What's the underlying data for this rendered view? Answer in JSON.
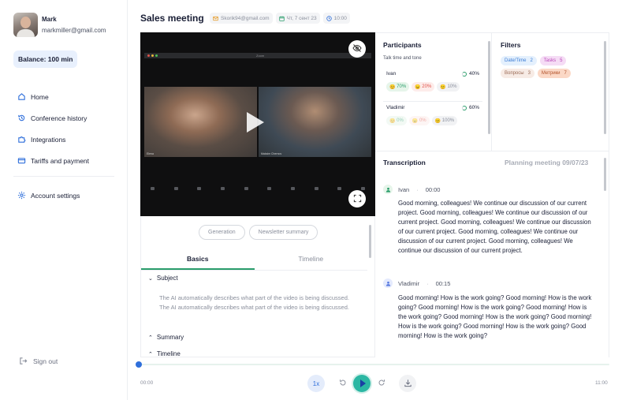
{
  "profile": {
    "name": "Mark",
    "email": "markmiller@gmail.com"
  },
  "balance": "Balance: 100 min",
  "nav": {
    "items": [
      {
        "label": "Home",
        "icon": "home-icon"
      },
      {
        "label": "Conference history",
        "icon": "history-icon"
      },
      {
        "label": "Integrations",
        "icon": "puzzle-icon"
      },
      {
        "label": "Tariffs and payment",
        "icon": "card-icon"
      }
    ],
    "settings": {
      "label": "Account settings",
      "icon": "gear-icon"
    },
    "signout": {
      "label": "Sign out",
      "icon": "signout-icon"
    }
  },
  "header": {
    "title": "Sales meeting",
    "email": "Skorik94@gmail.com",
    "date": "Чт, 7 сент 23",
    "time": "10:00"
  },
  "video": {
    "app_title": "Zoom",
    "feed1_name": "Elena",
    "feed2_name": "Maksim Chernov"
  },
  "actions": {
    "generation": "Generation",
    "newsletter": "Newsletter summary"
  },
  "tabs": {
    "basics": "Basics",
    "timeline": "Timeline"
  },
  "sections": {
    "subject": "Subject",
    "subject_text": "The AI automatically describes what part of the video is being discussed. The AI automatically describes what part of the video is being discussed.",
    "summary": "Summary",
    "timeline": "Timeline"
  },
  "participants": {
    "title": "Participants",
    "subtitle": "Talk time and tone",
    "people": [
      {
        "name": "Ivan",
        "pct": "40%",
        "pos": "70%",
        "neg": "20%",
        "neu": "10%"
      },
      {
        "name": "Vladimir",
        "pct": "60%",
        "pos": "0%",
        "neg": "0%",
        "neu": "100%"
      }
    ]
  },
  "filters": {
    "title": "Filters",
    "tags": [
      {
        "label": "Date/Time",
        "count": "2"
      },
      {
        "label": "Tasks",
        "count": "5"
      },
      {
        "label": "Вопросы",
        "count": "3"
      },
      {
        "label": "Метрики",
        "count": "7"
      }
    ]
  },
  "transcription": {
    "title": "Transcription",
    "meeting": "Planning meeting 09/07/23",
    "entries": [
      {
        "speaker": "Ivan",
        "time": "00:00",
        "text": "Good morning, colleagues! We continue our discussion of our current project. Good morning, colleagues! We continue our discussion of our current project. Good morning, colleagues! We continue our discussion of our current project. Good morning, colleagues! We continue our discussion of our current project. Good morning, colleagues! We continue our discussion of our current project."
      },
      {
        "speaker": "Vladimir",
        "time": "00:15",
        "text": "Good morning! How is the work going? Good morning! How is the work going? Good morning! How is the work going? Good morning! How is the work going? Good morning! How is the work going? Good morning! How is the work going? Good morning! How is the work going? Good morning! How is the work going?"
      }
    ]
  },
  "player": {
    "start": "00:00",
    "end": "11:00",
    "speed": "1x",
    "progress": 0
  },
  "colors": {
    "accent": "#2f6fdb",
    "green": "#2a9d6b",
    "play": "#2bb7a3"
  }
}
